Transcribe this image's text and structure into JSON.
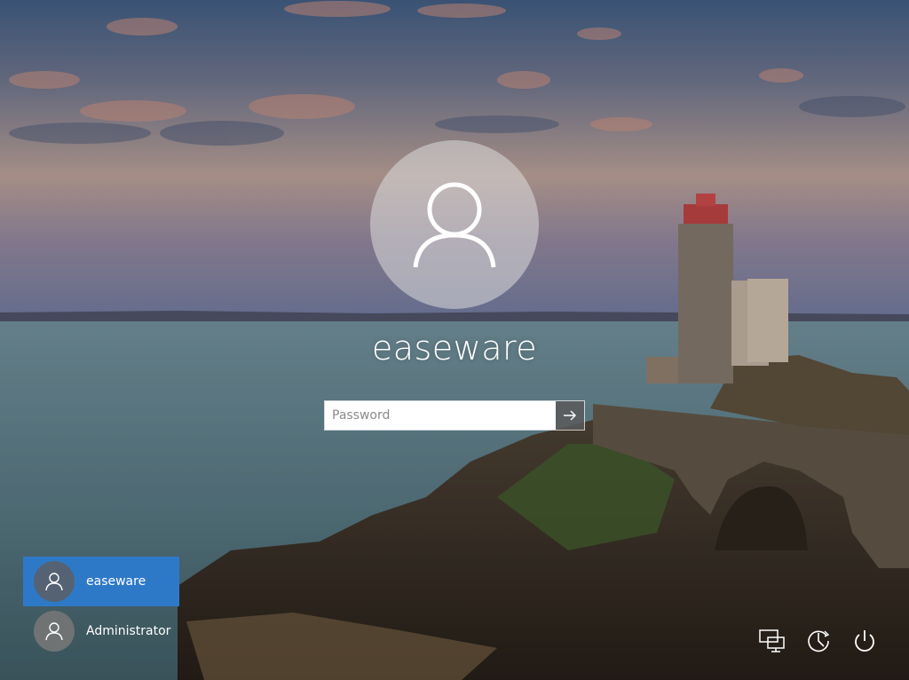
{
  "login": {
    "username": "easeware",
    "password_placeholder": "Password"
  },
  "users": [
    {
      "name": "easeware",
      "selected": true
    },
    {
      "name": "Administrator",
      "selected": false
    }
  ],
  "icons": {
    "avatar": "user-icon",
    "submit": "arrow-right-icon",
    "network": "network-icon",
    "ease_of_access": "ease-of-access-icon",
    "power": "power-icon"
  },
  "colors": {
    "selected_user": "#2e79c7"
  }
}
